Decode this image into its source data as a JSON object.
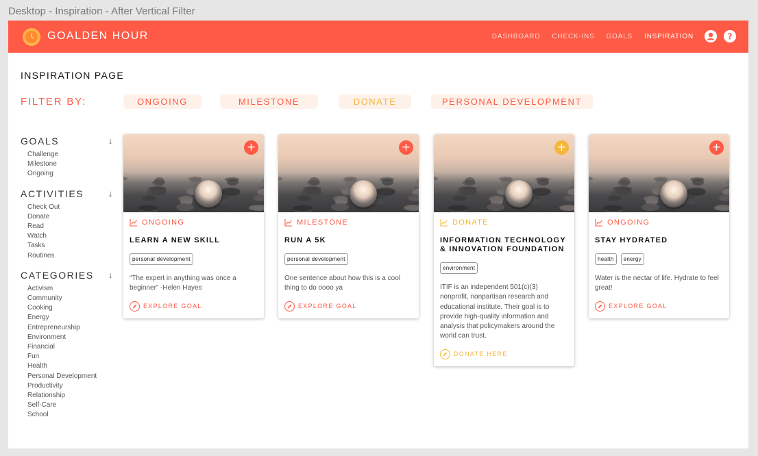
{
  "frame_title": "Desktop - Inspiration - After Vertical Filter",
  "colors": {
    "accent": "#ff5a45",
    "yellow": "#f5b73a",
    "navbar": "#ff5a45"
  },
  "header": {
    "brand": "GOALDEN HOUR",
    "logo_icon": "sun-clock-icon",
    "nav": [
      "DASHBOARD",
      "CHECK-INS",
      "GOALS",
      "INSPIRATION"
    ],
    "active_nav": "INSPIRATION",
    "user_icon": "user-icon",
    "help_icon": "help-icon"
  },
  "page": {
    "title": "INSPIRATION PAGE"
  },
  "filter": {
    "label": "FILTER BY:",
    "chips": [
      {
        "label": "ONGOING",
        "color": "#ff5a45"
      },
      {
        "label": "MILESTONE",
        "color": "#ff5a45"
      },
      {
        "label": "DONATE",
        "color": "#f5b73a"
      },
      {
        "label": "PERSONAL DEVELOPMENT",
        "color": "#ff5a45"
      }
    ]
  },
  "sidebar": {
    "sections": [
      {
        "title": "GOALS",
        "items": [
          "Challenge",
          "Milestone",
          "Ongoing"
        ]
      },
      {
        "title": "ACTIVITIES",
        "items": [
          "Check Out",
          "Donate",
          "Read",
          "Watch",
          "Tasks",
          "Routines"
        ]
      },
      {
        "title": "CATEGORIES",
        "items": [
          "Activism",
          "Community",
          "Cooking",
          "Energy",
          "Entrepreneurship",
          "Environment",
          "Financial",
          "Fun",
          "Health",
          "Personal Development",
          "Productivity",
          "Relationship",
          "Self-Care",
          "School"
        ]
      }
    ]
  },
  "cards": [
    {
      "type": "ONGOING",
      "color": "#ff5a45",
      "title": "LEARN A NEW SKILL",
      "tags": [
        "personal development"
      ],
      "desc": "“The expert in anything was once a beginner” -Helen Hayes",
      "action": "EXPLORE GOAL"
    },
    {
      "type": "MILESTONE",
      "color": "#ff5a45",
      "title": "RUN A 5K",
      "tags": [
        "personal development"
      ],
      "desc": "One sentence about how this is a cool thing to do oooo ya",
      "action": "EXPLORE GOAL"
    },
    {
      "type": "DONATE",
      "color": "#f5b73a",
      "title": "INFORMATION TECHNOLOGY & INNOVATION FOUNDATION",
      "tags": [
        "environment"
      ],
      "desc": "ITIF is an independent 501(c)(3) nonprofit, nonpartisan research and educational institute. Their goal is to provide high-quality information and analysis that policymakers around the world can trust.",
      "action": "DONATE HERE"
    },
    {
      "type": "ONGOING",
      "color": "#ff5a45",
      "title": "STAY HYDRATED",
      "tags": [
        "health",
        "energy"
      ],
      "desc": "Water is the nectar of life. Hydrate to feel great!",
      "action": "EXPLORE GOAL"
    }
  ]
}
